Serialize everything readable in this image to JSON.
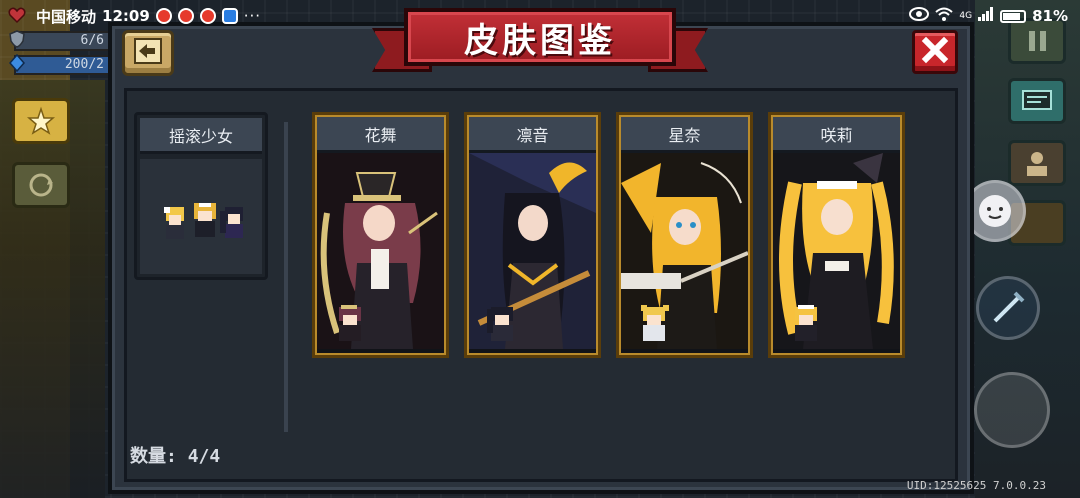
{
  "status_bar": {
    "carrier": "中国移动",
    "time": "12:09",
    "signal_label": "4G",
    "battery": "81%",
    "more": "···"
  },
  "hud": {
    "health": "6/6",
    "energy": "200/2"
  },
  "dialog": {
    "title": "皮肤图鉴",
    "category": "摇滚少女",
    "count_label": "数量:",
    "count_value": "4/4"
  },
  "skins": [
    {
      "name": "花舞",
      "accent": "#d9c27a",
      "bg": "#1a1216"
    },
    {
      "name": "凛音",
      "accent": "#f0b62a",
      "bg": "#1f2238"
    },
    {
      "name": "星奈",
      "accent": "#f2b52c",
      "bg": "#1b1712"
    },
    {
      "name": "咲莉",
      "accent": "#f7c13d",
      "bg": "#16161a"
    }
  ],
  "colors": {
    "banner": "#b0242a",
    "card_border": "#b98b2c",
    "panel": "#2b333d"
  },
  "icons": {
    "back": "back-arrow-icon",
    "close": "close-x-icon"
  },
  "footer": {
    "uid": "UID:12525625 7.0.0.23"
  }
}
